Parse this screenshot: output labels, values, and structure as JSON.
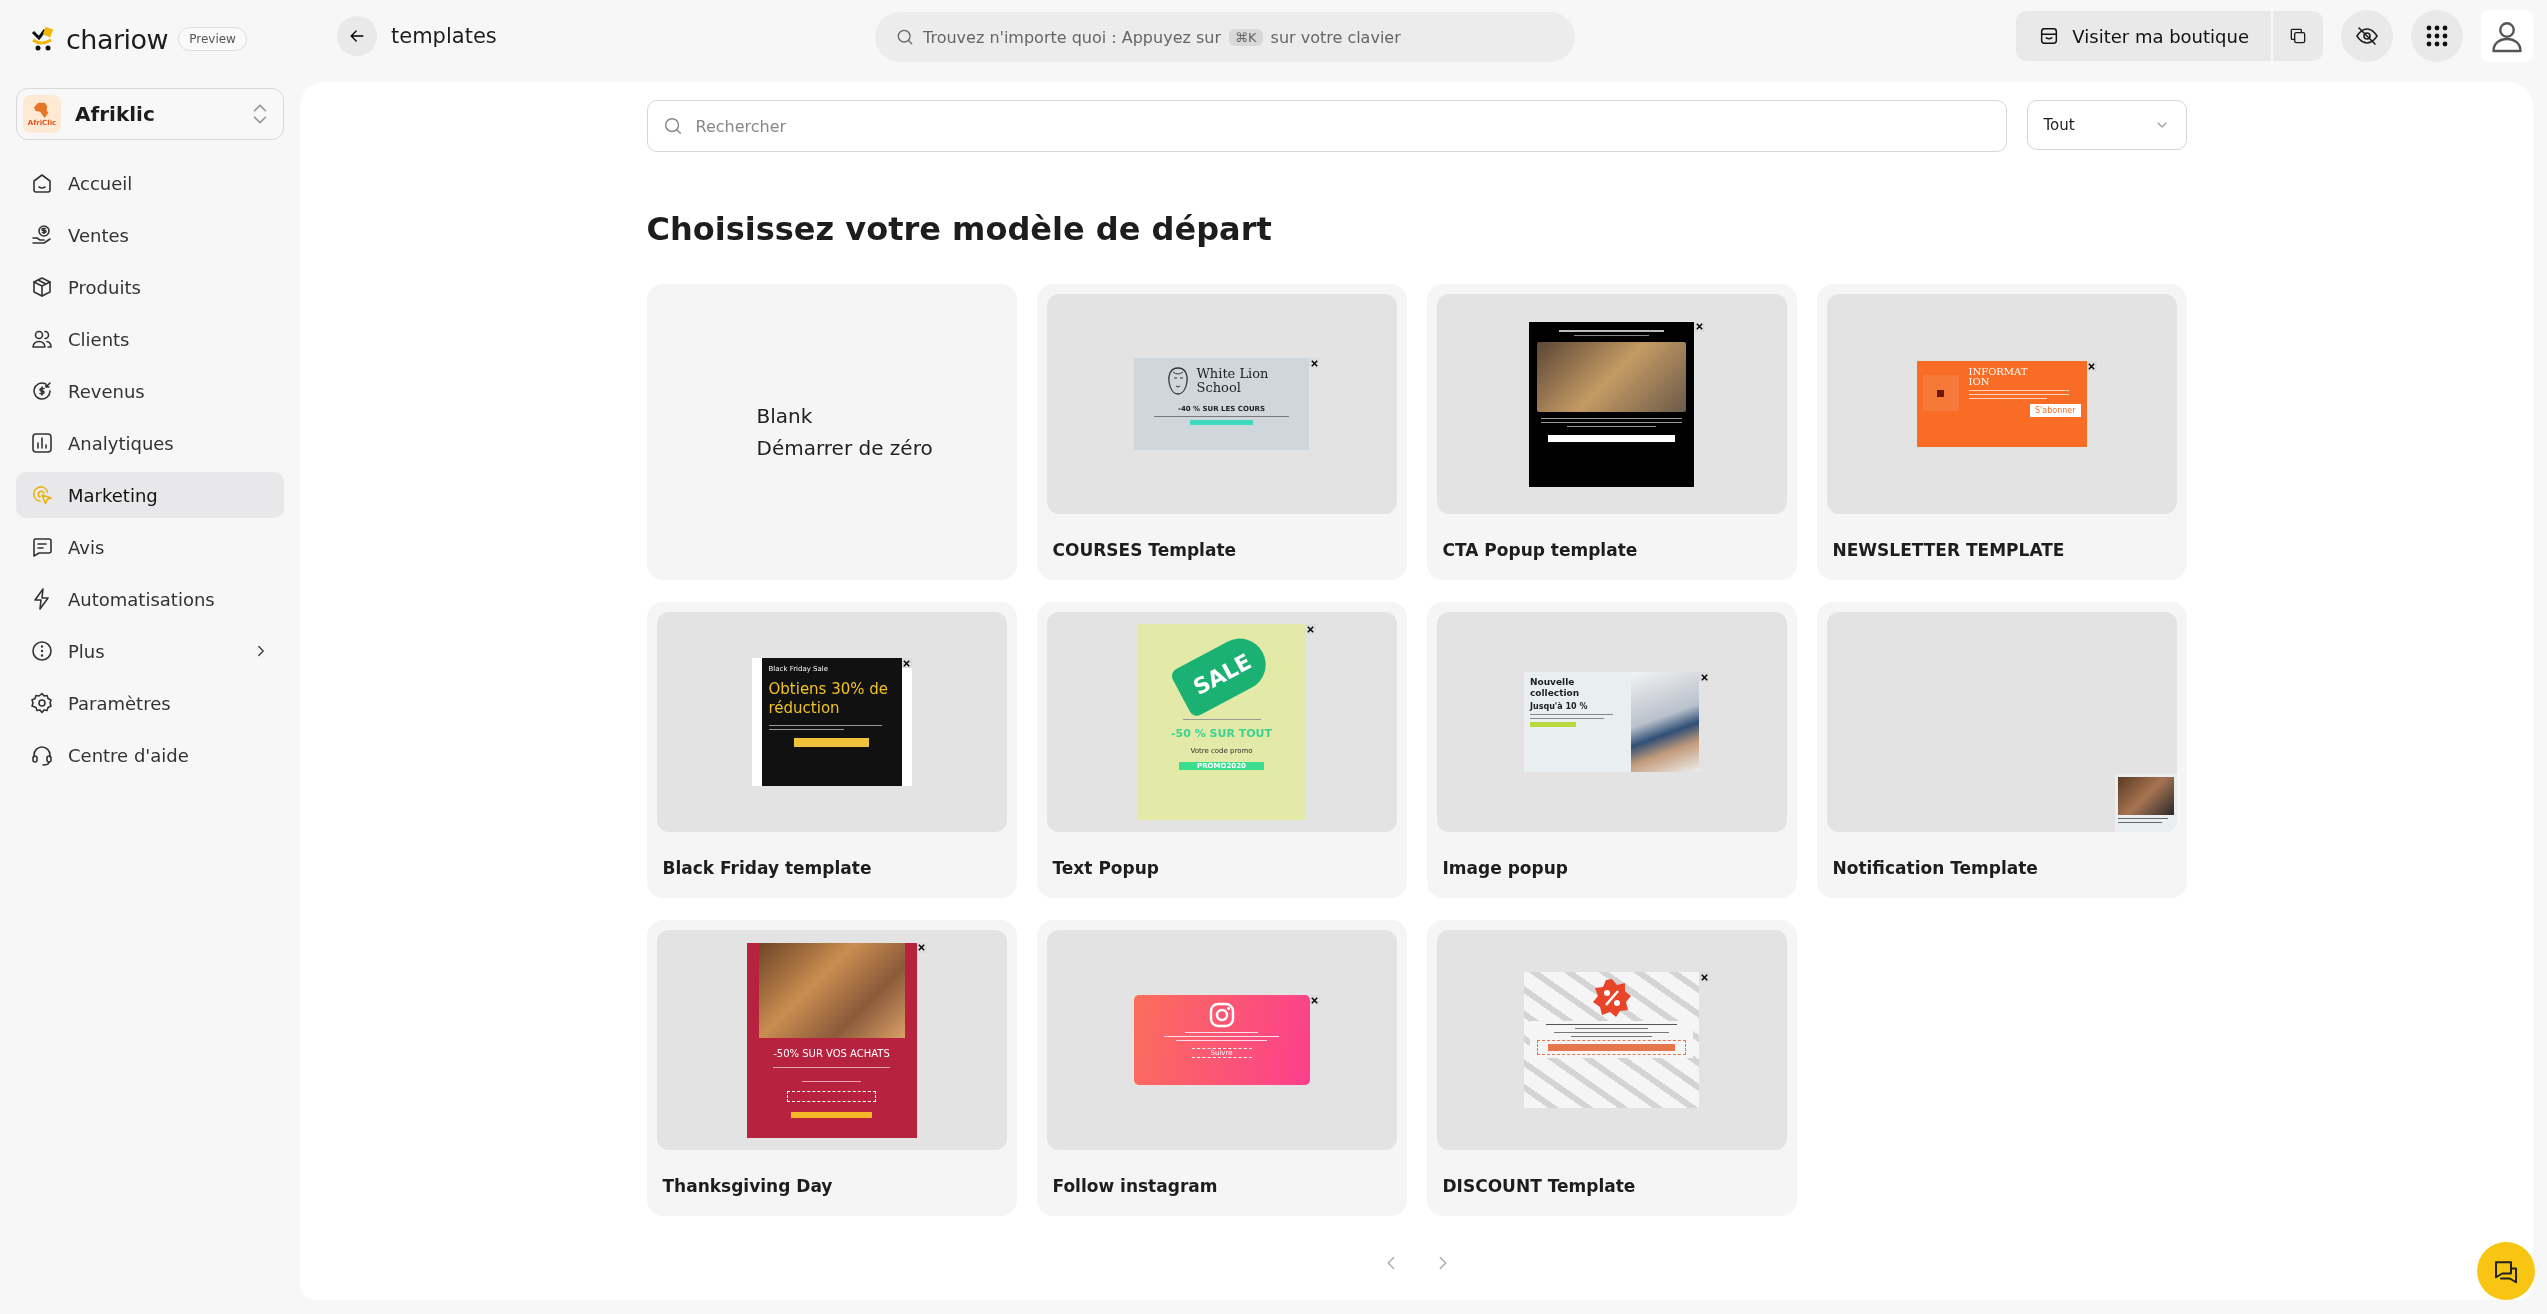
{
  "brand": {
    "name": "chariow",
    "badge": "Preview"
  },
  "store": {
    "name": "Afriklic",
    "logo_text": "AfriClic"
  },
  "nav": [
    {
      "label": "Accueil",
      "selected": false,
      "has_submenu": false
    },
    {
      "label": "Ventes",
      "selected": false,
      "has_submenu": false
    },
    {
      "label": "Produits",
      "selected": false,
      "has_submenu": false
    },
    {
      "label": "Clients",
      "selected": false,
      "has_submenu": false
    },
    {
      "label": "Revenus",
      "selected": false,
      "has_submenu": false
    },
    {
      "label": "Analytiques",
      "selected": false,
      "has_submenu": false
    },
    {
      "label": "Marketing",
      "selected": true,
      "has_submenu": false
    },
    {
      "label": "Avis",
      "selected": false,
      "has_submenu": false
    },
    {
      "label": "Automatisations",
      "selected": false,
      "has_submenu": false
    },
    {
      "label": "Plus",
      "selected": false,
      "has_submenu": true
    },
    {
      "label": "Paramètres",
      "selected": false,
      "has_submenu": false
    },
    {
      "label": "Centre d'aide",
      "selected": false,
      "has_submenu": false
    }
  ],
  "topbar": {
    "page_title": "templates",
    "search": {
      "placeholder_before": "Trouvez n'importe quoi : Appuyez sur",
      "shortcut": "⌘K",
      "placeholder_after": "sur votre clavier"
    },
    "visit_button": "Visiter ma boutique"
  },
  "filter": {
    "search_placeholder": "Rechercher",
    "category": "Tout"
  },
  "heading": "Choisissez votre modèle de départ",
  "templates": [
    {
      "kind": "blank",
      "title": "Blank",
      "subtitle": "Démarrer de zéro"
    },
    {
      "kind": "courses",
      "name": "COURSES Template",
      "brand": "White Lion School",
      "headline": "-40 % SUR LES COURS"
    },
    {
      "kind": "cta",
      "name": "CTA Popup template"
    },
    {
      "kind": "newsletter",
      "name": "NEWSLETTER TEMPLATE",
      "headline": "INFORMATION",
      "button": "S'abonner"
    },
    {
      "kind": "blackfriday",
      "name": "Black Friday template",
      "tag": "Black Friday Sale",
      "headline": "Obtiens 30% de réduction"
    },
    {
      "kind": "sale",
      "name": "Text Popup",
      "badge": "SALE",
      "headline": "-50 % SUR TOUT",
      "caption": "Votre code promo",
      "button": "PROMO2020"
    },
    {
      "kind": "image",
      "name": "Image popup",
      "headline": "Nouvelle collection",
      "subhead": "Jusqu'à 10 %"
    },
    {
      "kind": "notification",
      "name": "Notification Template"
    },
    {
      "kind": "thanksgiving",
      "name": "Thanksgiving Day",
      "headline": "-50% SUR VOS ACHATS"
    },
    {
      "kind": "instagram",
      "name": "Follow instagram",
      "button": "Suivre"
    },
    {
      "kind": "discount",
      "name": "DISCOUNT Template"
    }
  ]
}
